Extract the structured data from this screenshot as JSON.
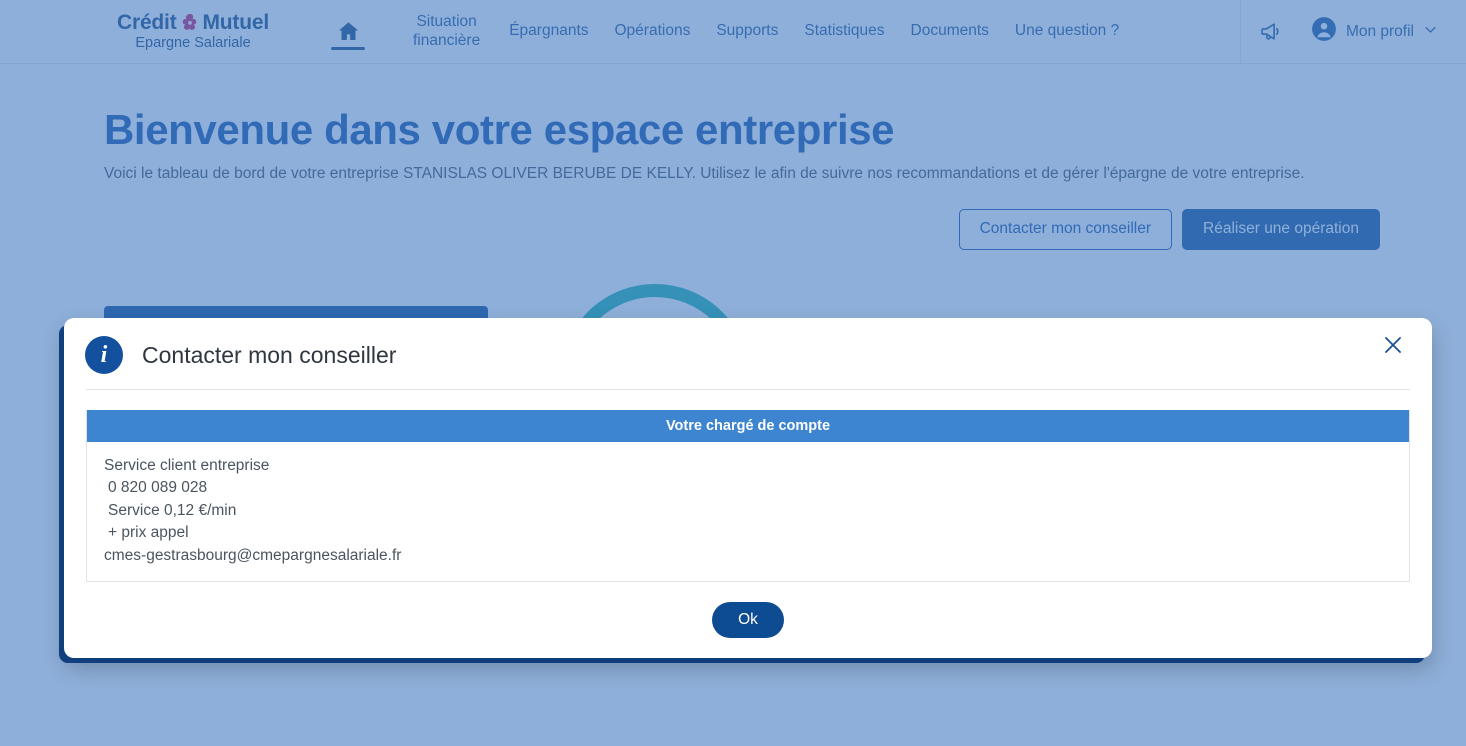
{
  "navbar": {
    "brand": {
      "line1_a": "Crédit",
      "line1_b": "Mutuel",
      "line2": "Epargne Salariale",
      "flower_icon": "credit-mutuel-flower-icon"
    },
    "home_icon": "home-icon",
    "links": [
      {
        "label": "Situation\nfinancière",
        "two_line": true
      },
      {
        "label": "Épargnants",
        "two_line": false
      },
      {
        "label": "Opérations",
        "two_line": false
      },
      {
        "label": "Supports",
        "two_line": false
      },
      {
        "label": "Statistiques",
        "two_line": false
      },
      {
        "label": "Documents",
        "two_line": false
      },
      {
        "label": "Une question ?",
        "two_line": false
      }
    ],
    "megaphone_icon": "megaphone-icon",
    "profile": {
      "avatar_icon": "user-avatar-icon",
      "label": "Mon profil",
      "chevron_icon": "chevron-down-icon"
    }
  },
  "hero": {
    "title": "Bienvenue dans votre espace entreprise",
    "subtitle": "Voici le tableau de bord de votre entreprise STANISLAS OLIVER BERUBE DE KELLY. Utilisez le afin de suivre nos recommandations et de gérer l'épargne de votre entreprise.",
    "btn_contact": "Contacter mon conseiller",
    "btn_operation": "Réaliser une opération"
  },
  "modal": {
    "info_icon": "info-icon",
    "info_glyph": "i",
    "title": "Contacter mon conseiller",
    "close_icon": "close-icon",
    "table": {
      "header": "Votre chargé de compte",
      "rows": [
        "Service client entreprise",
        "0 820 089 028",
        "Service 0,12 €/min",
        "+ prix appel",
        "cmes-gestrasbourg@cmepargnesalariale.fr"
      ]
    },
    "ok_label": "Ok"
  },
  "colors": {
    "brand_blue": "#0d3f7d",
    "brand_pink": "#c8176a",
    "title_blue": "#0b4aa2",
    "button_blue": "#0d4b93",
    "table_header_blue": "#3d85d1",
    "card_blue": "#034694",
    "donut_teal": "#16b0a8",
    "overlay": "#7d9fcb"
  }
}
